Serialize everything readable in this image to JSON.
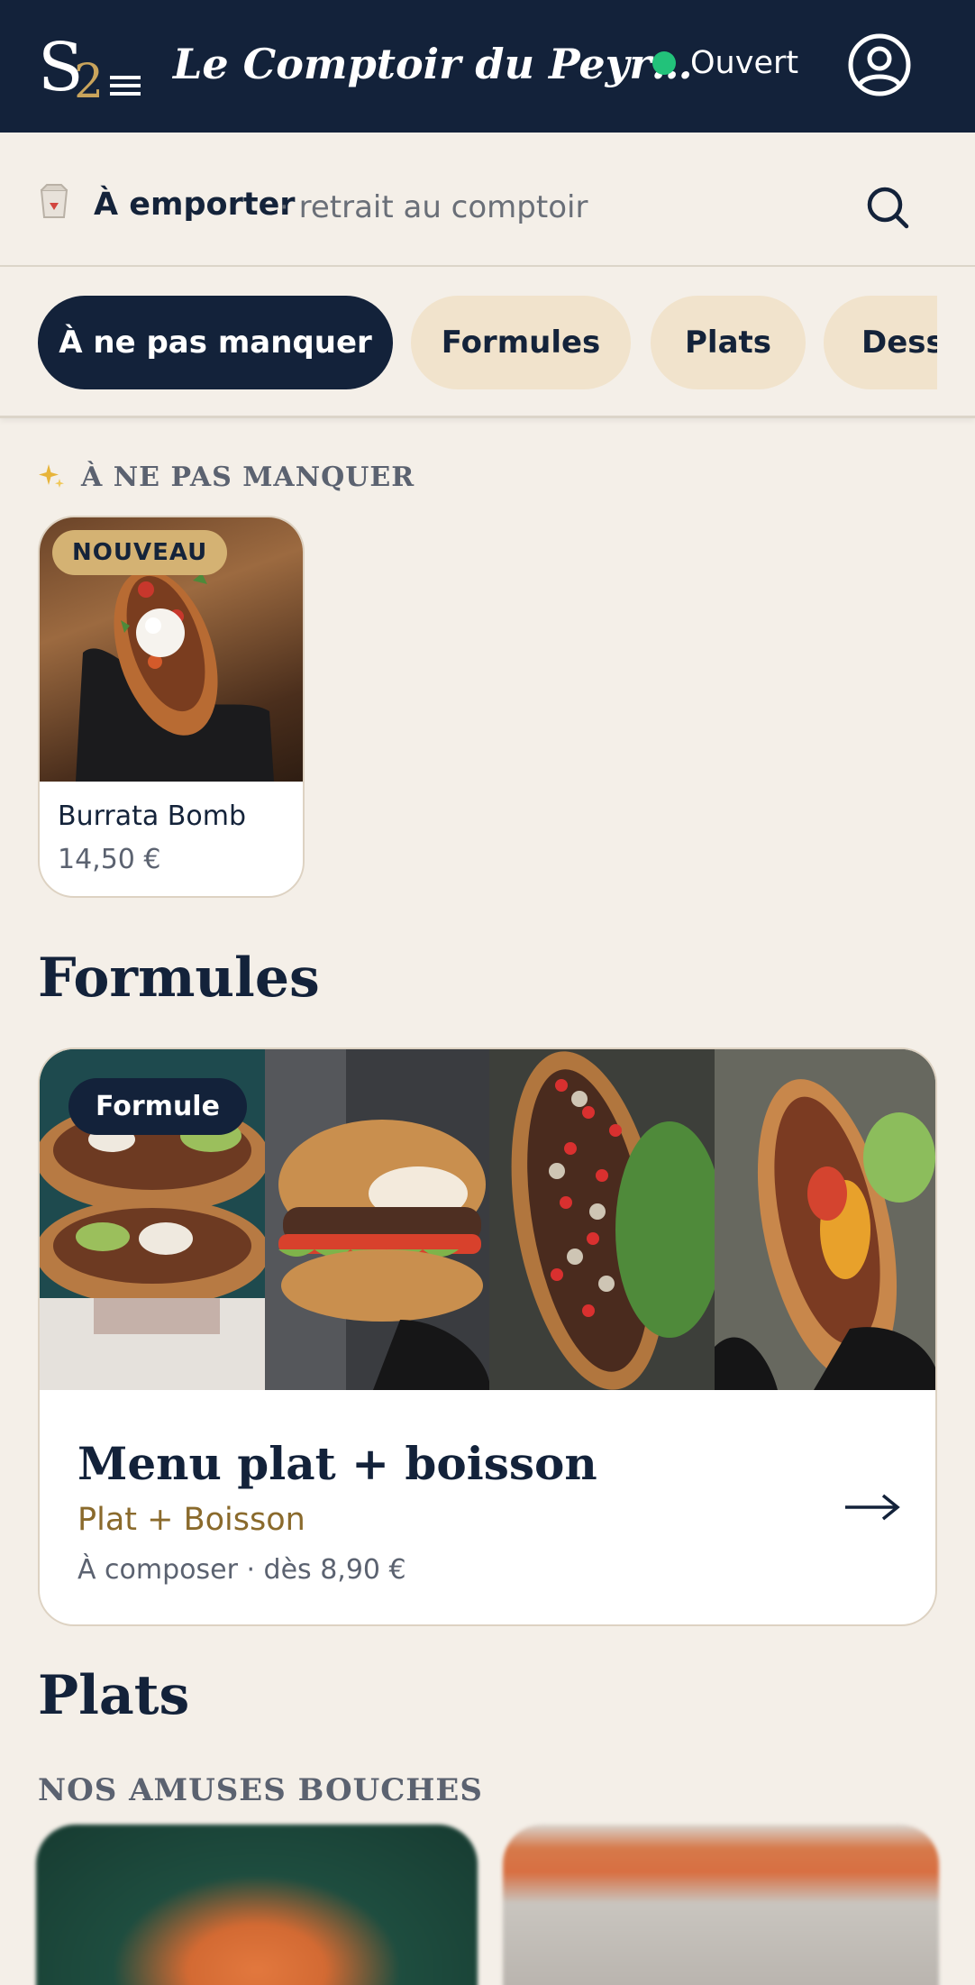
{
  "header": {
    "title": "Le Comptoir du Peyr…",
    "status": "Ouvert",
    "colors": {
      "bar": "#13223a",
      "status_dot": "#22c27a"
    }
  },
  "mode": {
    "label": "À emporter",
    "detail": "· retrait au comptoir"
  },
  "categories": [
    {
      "label": "À ne pas manquer",
      "active": true
    },
    {
      "label": "Formules",
      "active": false
    },
    {
      "label": "Plats",
      "active": false
    },
    {
      "label": "Desserts",
      "active": false
    }
  ],
  "highlights": {
    "heading": "À NE PAS MANQUER",
    "items": [
      {
        "badge": "NOUVEAU",
        "name": "Burrata Bomb",
        "price": "14,50 €"
      }
    ]
  },
  "formules": {
    "heading": "Formules",
    "card": {
      "badge": "Formule",
      "title": "Menu plat + boisson",
      "subtitle": "Plat + Boisson",
      "meta": "À composer · dès 8,90 €"
    }
  },
  "plats": {
    "heading": "Plats",
    "subheading": "NOS AMUSES BOUCHES"
  },
  "icons": [
    "logo-icon",
    "account-icon",
    "takeaway-bag-icon",
    "search-icon",
    "sparkle-icon",
    "arrow-right-icon"
  ]
}
